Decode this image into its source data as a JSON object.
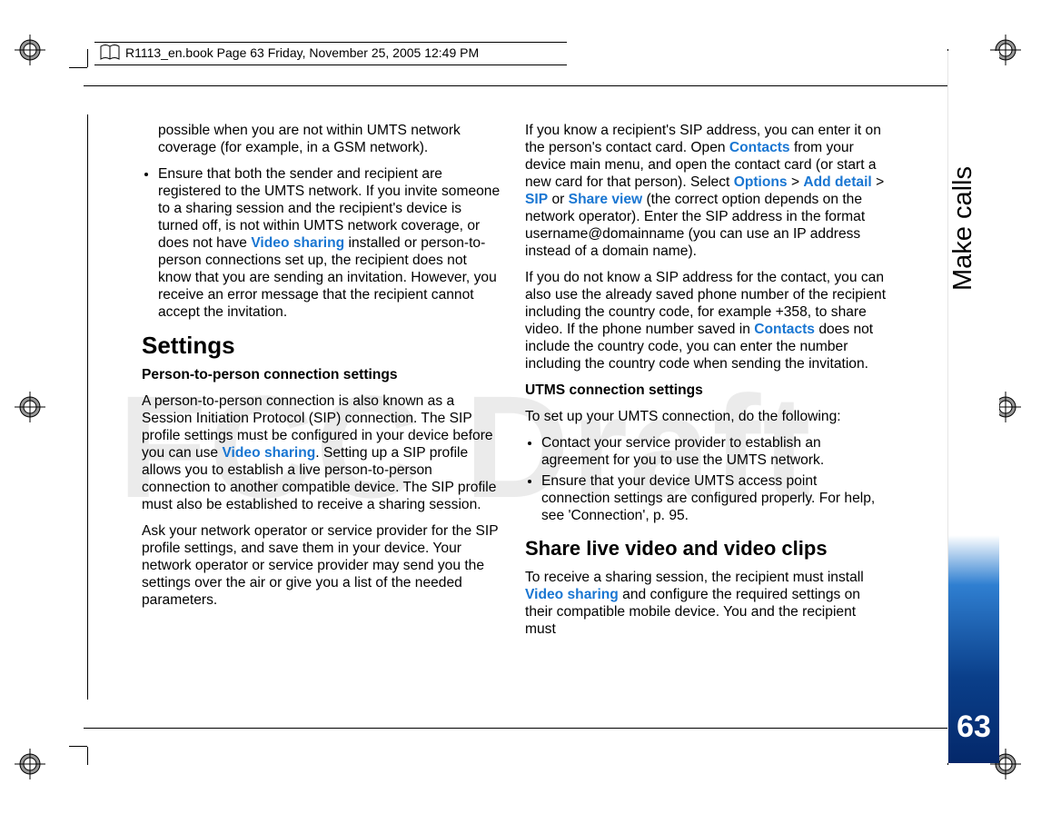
{
  "header": {
    "text": "R1113_en.book  Page 63  Friday, November 25, 2005  12:49 PM"
  },
  "watermark": "FCC Draft",
  "side": {
    "chapter": "Make calls",
    "page": "63"
  },
  "left": {
    "cont1": "possible when you are not within UMTS network coverage (for example, in a GSM network).",
    "bullet1a": "Ensure that both the sender and recipient are registered to the UMTS network. If you invite someone to a sharing session and the recipient's device is turned off, is not within UMTS network coverage, or does not have ",
    "bullet1link": "Video sharing",
    "bullet1b": " installed or person-to-person connections set up, the recipient does not know that you are sending an invitation. However, you receive an error message that the recipient cannot accept the invitation.",
    "settings_h": "Settings",
    "p2p_h": "Person-to-person connection settings",
    "p2p_1a": "A person-to-person connection is also known as a Session Initiation Protocol (SIP) connection. The SIP profile settings must be configured in your device before you can use ",
    "p2p_1link": "Video sharing",
    "p2p_1b": ". Setting up a SIP profile allows you to establish a live person-to-person connection to another compatible device. The SIP profile must also be established to receive a sharing session.",
    "p2p_2": "Ask your network operator or service provider for the SIP profile settings, and save them in your device. Your network operator or service provider may send you the settings over the air or give you a list of the needed parameters."
  },
  "right": {
    "sip_1a": "If you know a recipient's SIP address, you can enter it on the person's contact card. Open ",
    "sip_link_contacts": "Contacts",
    "sip_1b": " from your device main menu, and open the contact card (or start a new card for that person). Select ",
    "sip_link_options": "Options",
    "sip_gt1": " > ",
    "sip_link_add": "Add detail",
    "sip_gt2": " > ",
    "sip_link_sip": "SIP",
    "sip_or": " or ",
    "sip_link_share": "Share view",
    "sip_1c": " (the correct option depends on the network operator). Enter the SIP address in the format username@domainname (you can use an IP address instead of a domain name).",
    "sip_2a": "If you do not know a SIP address for the contact, you can also use the already saved phone number of the recipient including the country code, for example +358, to share video. If the phone number saved in ",
    "sip_2link": "Contacts",
    "sip_2b": " does not include the country code, you can enter the number including the country code when sending the invitation.",
    "utms_h": "UTMS connection settings",
    "utms_1": "To set up your UMTS connection, do the following:",
    "utms_b1": "Contact your service provider to establish an agreement for you to use the UMTS network.",
    "utms_b2": "Ensure that your device UMTS access point connection settings are configured properly. For help, see 'Connection', p. 95.",
    "share_h": "Share live video and video clips",
    "share_1a": "To receive a sharing session, the recipient must install ",
    "share_link": "Video sharing",
    "share_1b": " and configure the required settings on their compatible mobile device. You and the recipient must"
  }
}
